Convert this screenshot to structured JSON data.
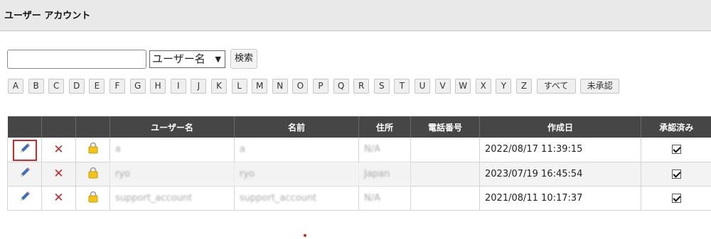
{
  "header": {
    "title": "ユーザー アカウント"
  },
  "search": {
    "value": "",
    "placeholder": "",
    "field_selected": "ユーザー名",
    "search_button": "検索"
  },
  "letters": [
    "A",
    "B",
    "C",
    "D",
    "E",
    "F",
    "G",
    "H",
    "I",
    "J",
    "K",
    "L",
    "M",
    "N",
    "O",
    "P",
    "Q",
    "R",
    "S",
    "T",
    "U",
    "V",
    "W",
    "X",
    "Y",
    "Z",
    "すべて",
    "未承認"
  ],
  "table": {
    "columns": [
      "",
      "",
      "",
      "ユーザー名",
      "名前",
      "住所",
      "電話番号",
      "作成日",
      "承認済み"
    ],
    "rows": [
      {
        "username": "a",
        "name": "a",
        "address": "N/A",
        "phone": "",
        "created": "2022/08/17 11:39:15",
        "approved": true
      },
      {
        "username": "ryo",
        "name": "ryo",
        "address": "Japan",
        "phone": "",
        "created": "2023/07/19 16:45:54",
        "approved": true
      },
      {
        "username": "support_account",
        "name": "support_account",
        "address": "N/A",
        "phone": "",
        "created": "2021/08/11 10:17:37",
        "approved": true
      }
    ]
  },
  "icons": {
    "edit": "pencil-icon",
    "delete": "x-icon",
    "lock": "padlock-icon"
  },
  "colors": {
    "header_bg": "#464646",
    "delete_red": "#c9242a",
    "highlight_red": "#d6262b",
    "pencil_blue": "#3a6fc4",
    "lock_yellow": "#f2c318"
  }
}
